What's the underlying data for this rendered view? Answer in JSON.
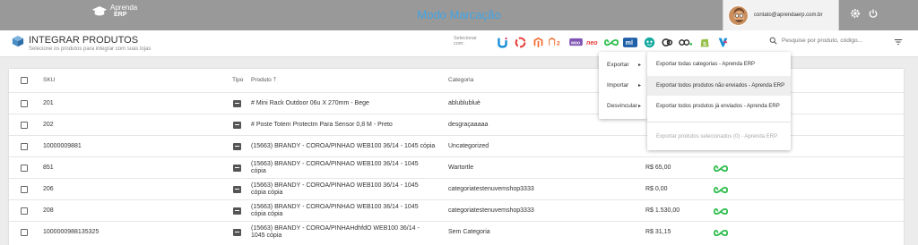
{
  "topbar": {
    "logo_line1": "Aprenda",
    "logo_line2": "ERP",
    "welcome": "Modo Marcação",
    "user_email": "contato@aprendaerp.com.br"
  },
  "header": {
    "title": "INTEGRAR PRODUTOS",
    "subtitle": "Selecione os produtos para integrar com suas lojas",
    "select_label": "Selecionar com:",
    "search_placeholder": "Pesquise por produto, código..."
  },
  "stores": [
    "Loja Integrada",
    "Uappi",
    "Magento",
    "Magento 2",
    "WooCommerce",
    "Neo",
    "Aprenda ERP",
    "Mercado Livre",
    "Tray",
    "Olist",
    "Oo",
    "Shopify",
    "Vnda"
  ],
  "table": {
    "columns": [
      "SKU",
      "Tipo",
      "Produto",
      "Categoria"
    ],
    "rows": [
      {
        "sku": "201",
        "product": "# Mini Rack Outdoor 06u X 270mm - Bege",
        "category": "ablublubluè",
        "price": "",
        "integrated": false
      },
      {
        "sku": "202",
        "product": "# Poste Totem Protectm Para Sensor 0,8 M - Preto",
        "category": "desgraçaaaaa",
        "price": "",
        "integrated": false
      },
      {
        "sku": "10000009881",
        "product": "(15663) BRANDY - COROA/PINHAO WEB100 36/14 - 1045 cópia",
        "category": "Uncategorized",
        "price": "",
        "integrated": false
      },
      {
        "sku": "851",
        "product": "(15663) BRANDY - COROA/PINHAO WEB100 36/14 - 1045 cópia",
        "category": "Wartortle",
        "price": "R$ 65,00",
        "integrated": true
      },
      {
        "sku": "206",
        "product": "(15663) BRANDY - COROA/PINHAO WEB100 36/14 - 1045 cópia cópia",
        "category": "categoriatestenuvemshop3333",
        "price": "R$ 0,00",
        "integrated": true
      },
      {
        "sku": "208",
        "product": "(15663) BRANDY - COROA/PINHAO WEB100 36/14 - 1045 cópia cópia",
        "category": "categoriatestenuvemshop3333",
        "price": "R$ 1.530,00",
        "integrated": true
      },
      {
        "sku": "1000000988135325",
        "product": "(15663) BRANDY - COROA/PINHAHdhfdO WEB100 36/14 - 1045 cópia",
        "category": "Sem Categoria",
        "price": "R$ 31,15",
        "integrated": true
      }
    ]
  },
  "menu": {
    "items": [
      "Exportar",
      "Importar",
      "Desvincular"
    ],
    "submenu": [
      "Exportar todas categorias - Aprenda ERP",
      "Exportar todos produtos não enviados - Aprenda ERP",
      "Exportar todos produtos já enviados - Aprenda ERP",
      "Exportar produtos selecionados (0) - Aprenda ERP"
    ]
  },
  "colors": {
    "accent": "#3fa4e6",
    "topbar": "#999999",
    "green": "#2bbd4a"
  }
}
